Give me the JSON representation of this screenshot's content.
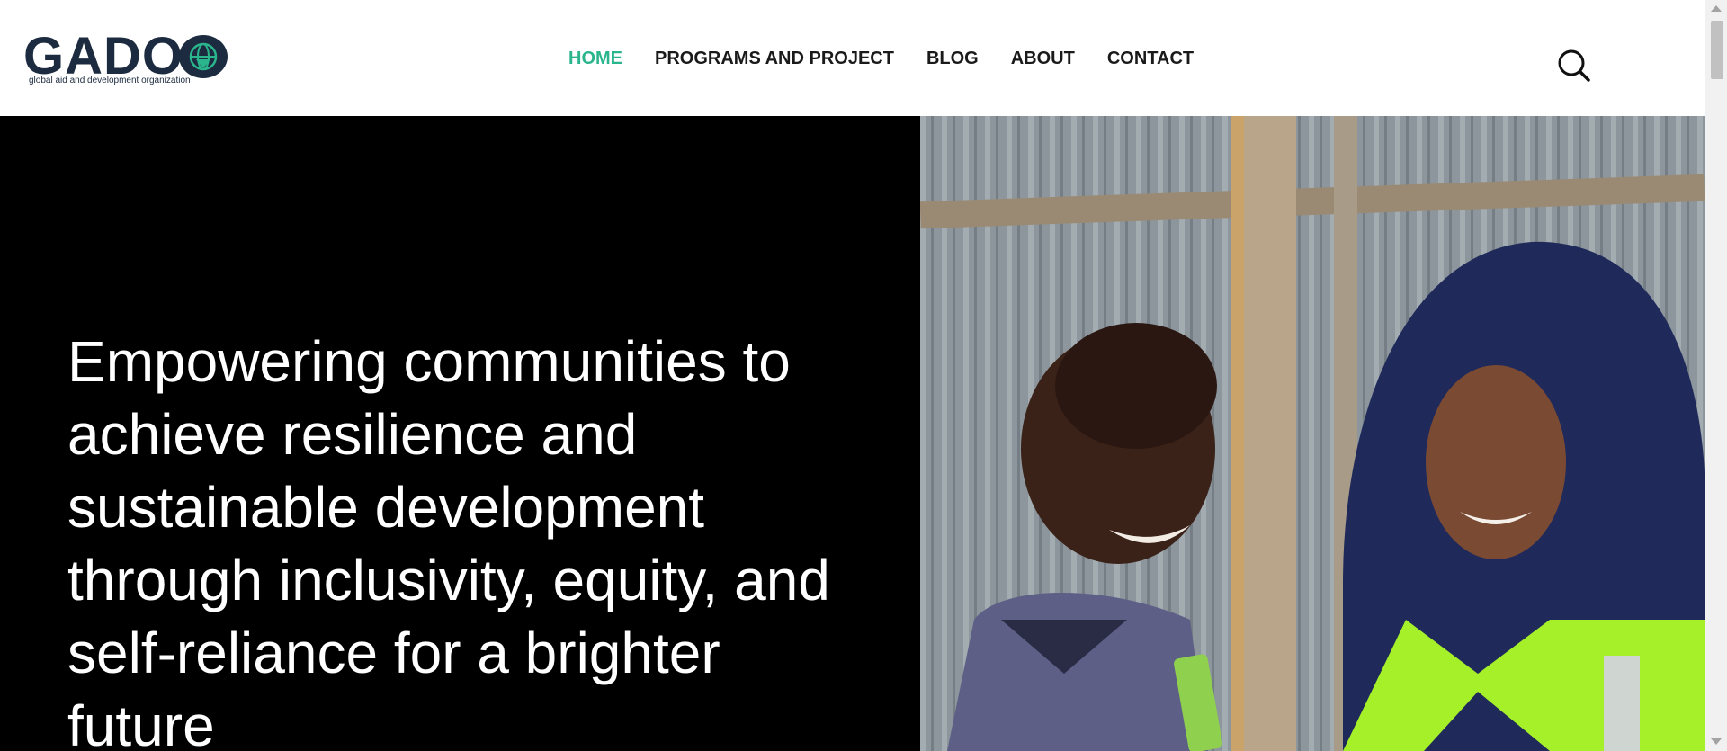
{
  "brand": {
    "logo_text": "GADO",
    "tagline": "global aid and development organization"
  },
  "nav": {
    "items": [
      {
        "label": "HOME",
        "active": true
      },
      {
        "label": "PROGRAMS AND PROJECT",
        "active": false
      },
      {
        "label": "BLOG",
        "active": false
      },
      {
        "label": "ABOUT",
        "active": false
      },
      {
        "label": "CONTACT",
        "active": false
      }
    ],
    "search_icon": "search-icon"
  },
  "hero": {
    "headline": "Empowering communities to achieve resilience and sustainable development through inclusivity, equity, and self-reliance for a brighter future",
    "image": "photo-child-and-aid-worker"
  },
  "colors": {
    "accent": "#2bb58d",
    "brand_navy": "#1c2b3f",
    "hero_bg": "#000000"
  }
}
